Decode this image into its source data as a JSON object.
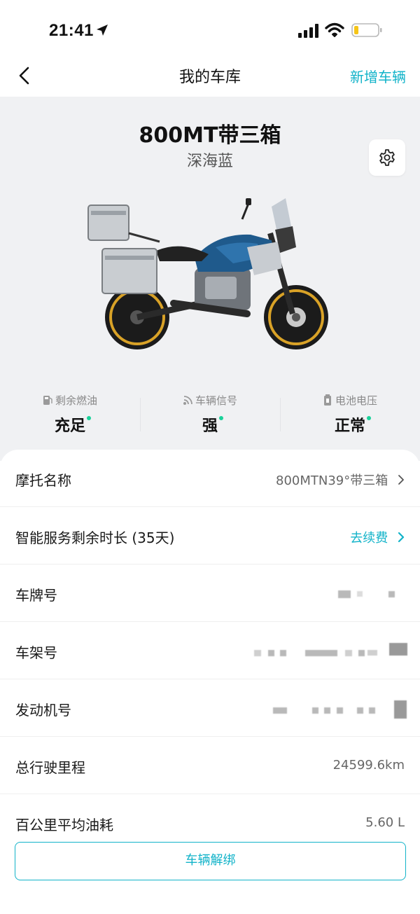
{
  "status_bar": {
    "time": "21:41"
  },
  "nav": {
    "title": "我的车库",
    "action": "新增车辆"
  },
  "vehicle": {
    "model": "800MT带三箱",
    "color": "深海蓝"
  },
  "stats": [
    {
      "label": "剩余燃油",
      "value": "充足",
      "icon": "fuel-icon"
    },
    {
      "label": "车辆信号",
      "value": "强",
      "icon": "signal-wave-icon"
    },
    {
      "label": "电池电压",
      "value": "正常",
      "icon": "battery-small-icon"
    }
  ],
  "details": {
    "name_label": "摩托名称",
    "name_value": "800MTN39°带三箱",
    "service_label": "智能服务剩余时长 (35天)",
    "service_action": "去续费",
    "plate_label": "车牌号",
    "frame_label": "车架号",
    "engine_label": "发动机号",
    "mileage_label": "总行驶里程",
    "mileage_value": "24599.6km",
    "fuel_label": "百公里平均油耗",
    "fuel_value": "5.60 L"
  },
  "footer": {
    "unbind": "车辆解绑"
  },
  "colors": {
    "accent": "#12b3c9",
    "status_dot": "#1ad19a",
    "hero_bg": "#f0f1f3"
  }
}
